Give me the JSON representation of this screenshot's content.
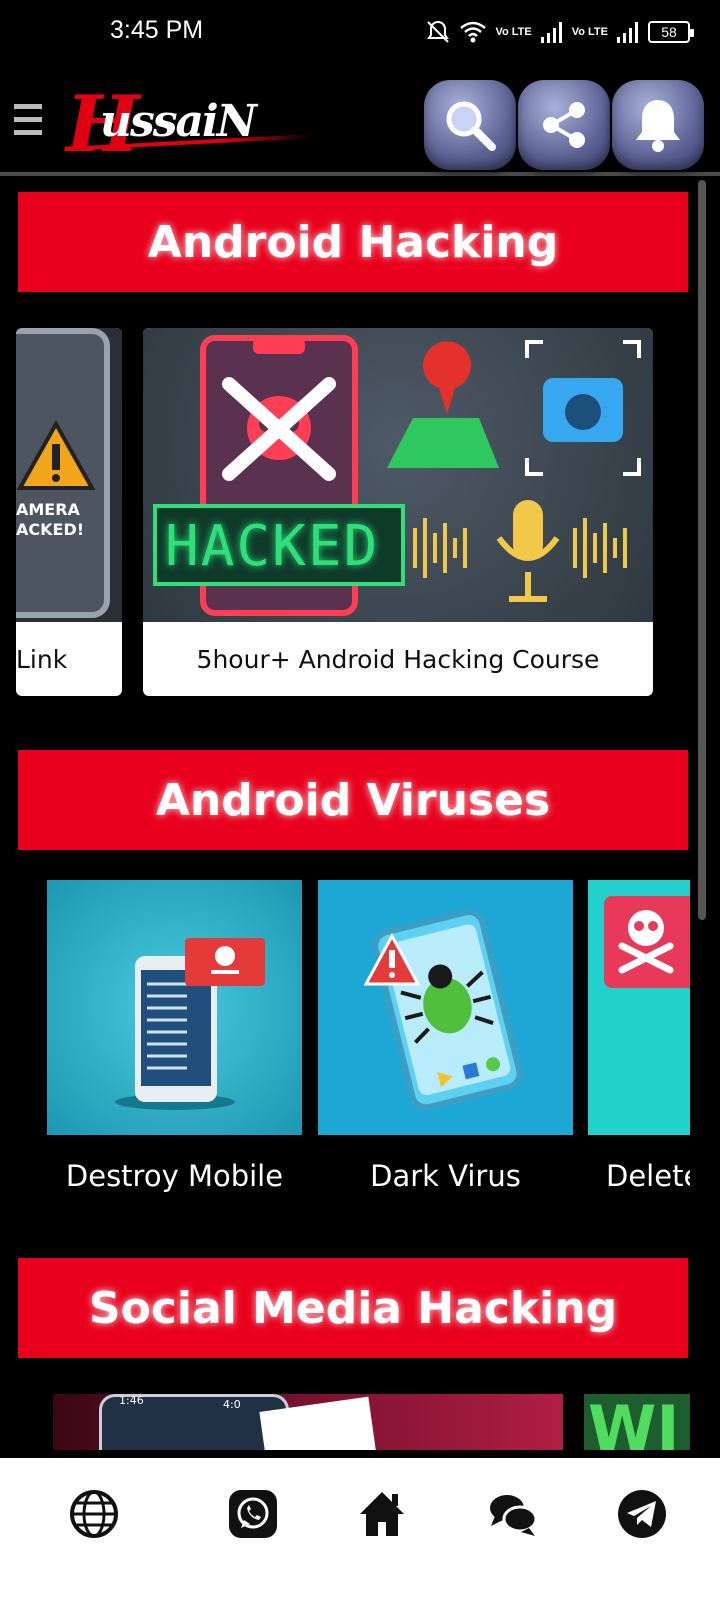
{
  "status_bar": {
    "time": "3:45 PM",
    "volte_1": "Vo LTE",
    "volte_2": "Vo LTE",
    "battery": "58"
  },
  "app_bar": {
    "logo_text": "ussaiN",
    "logo_initial": "H",
    "icons": [
      "menu-icon",
      "search-icon",
      "share-icon",
      "bell-icon"
    ]
  },
  "sections": [
    {
      "title": "Android Hacking",
      "cards": [
        {
          "title": "Link",
          "thumb_text": "AMERA\nACKED!"
        },
        {
          "title": "5hour+ Android Hacking Course",
          "thumb_text": "HACKED"
        }
      ]
    },
    {
      "title": "Android Viruses",
      "cards": [
        {
          "title": "Destroy Mobile"
        },
        {
          "title": "Dark Virus"
        },
        {
          "title": "Delete"
        }
      ]
    },
    {
      "title": "Social Media Hacking",
      "cards": [
        {
          "title": "",
          "thumb_text_1": "1:46",
          "thumb_text_2": "4:0"
        },
        {
          "title": "",
          "thumb_text": "WI"
        }
      ]
    }
  ],
  "bottom_nav": {
    "items": [
      "globe-icon",
      "whatsapp-icon",
      "home-icon",
      "chat-icon",
      "telegram-icon"
    ]
  },
  "colors": {
    "accent_red": "#e8001c",
    "background": "#000000",
    "nav_background": "#ffffff",
    "virus_teal": "#1fa4c9"
  }
}
